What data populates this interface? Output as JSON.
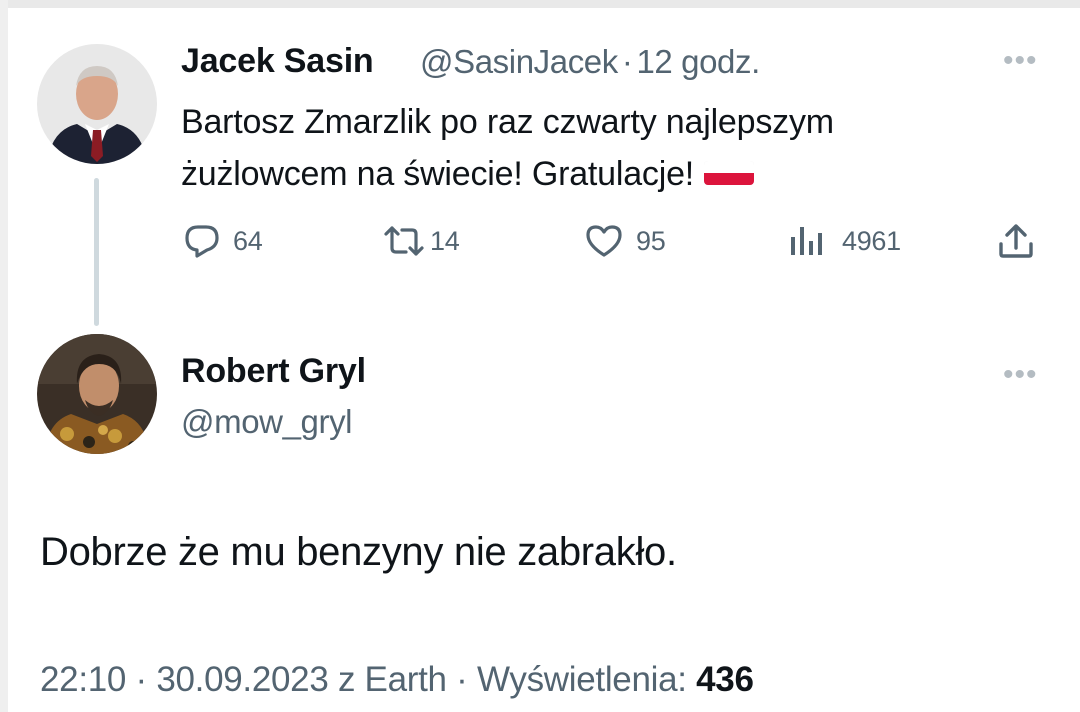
{
  "tweet": {
    "author_name": "Jacek Sasin",
    "author_handle": "@SasinJacek",
    "separator": "·",
    "time": "12 godz.",
    "text_line1": "Bartosz Zmarzlik po raz czwarty najlepszym",
    "text_line2": "żużlowcem na świecie! Gratulacje!",
    "flag_icon": "poland-flag-emoji",
    "stats": {
      "replies": "64",
      "retweets": "14",
      "likes": "95",
      "views": "4961"
    }
  },
  "reply": {
    "author_name": "Robert Gryl",
    "author_handle": "@mow_gryl",
    "text": "Dobrze że mu benzyny nie zabrakło.",
    "footer": {
      "time": "22:10",
      "separator": "·",
      "date": "30.09.2023",
      "source": "z Earth",
      "views_label": "Wyświetlenia:",
      "views_count": "436"
    }
  },
  "icons": {
    "more": "more-horizontal-icon",
    "reply": "reply-bubble-icon",
    "retweet": "retweet-icon",
    "like": "heart-icon",
    "views": "bar-chart-icon",
    "share": "share-upload-icon"
  },
  "colors": {
    "text": "#0f1419",
    "secondary": "#536471",
    "thread_line": "#cfd9de",
    "flag_red": "#dc143c"
  }
}
